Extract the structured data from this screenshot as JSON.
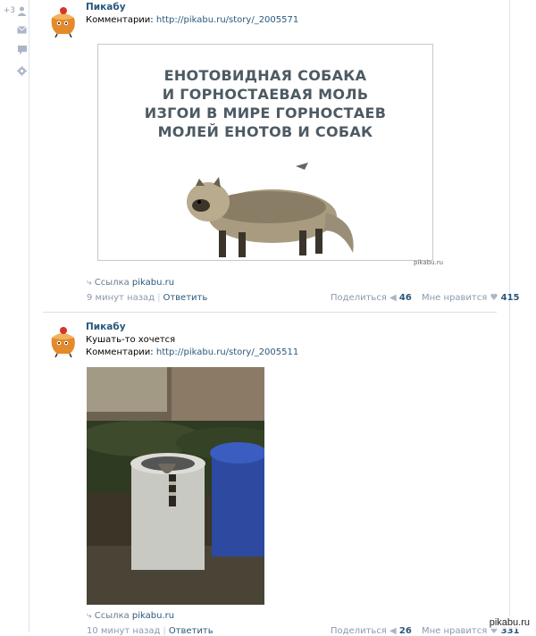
{
  "leftrail": {
    "friends_count": "+3"
  },
  "posts": [
    {
      "author": "Пикабу",
      "text": "",
      "comments_label": "Комментарии:",
      "comments_url": "http://pikabu.ru/story/_2005571",
      "image_title_lines": [
        "ЕНОТОВИДНАЯ СОБАКА",
        "И ГОРНОСТАЕВАЯ МОЛЬ",
        "ИЗГОИ В МИРЕ ГОРНОСТАЕВ",
        "МОЛЕЙ ЕНОТОВ И СОБАК"
      ],
      "image_watermark": "pikabu.ru",
      "link_label": "Ссылка",
      "link_domain": "pikabu.ru",
      "time": "9 минут назад",
      "reply": "Ответить",
      "share_label": "Поделиться",
      "share_count": "46",
      "like_label": "Мне нравится",
      "like_count": "415"
    },
    {
      "author": "Пикабу",
      "text": "Кушать-то хочется",
      "comments_label": "Комментарии:",
      "comments_url": "http://pikabu.ru/story/_2005511",
      "link_label": "Ссылка",
      "link_domain": "pikabu.ru",
      "time": "10 минут назад",
      "reply": "Ответить",
      "share_label": "Поделиться",
      "share_count": "26",
      "like_label": "Мне нравится",
      "like_count": "331"
    }
  ],
  "badge": "pikabu.ru",
  "colors": {
    "link": "#2b587a",
    "muted": "#8a9aae",
    "divider": "#dae1e8"
  }
}
